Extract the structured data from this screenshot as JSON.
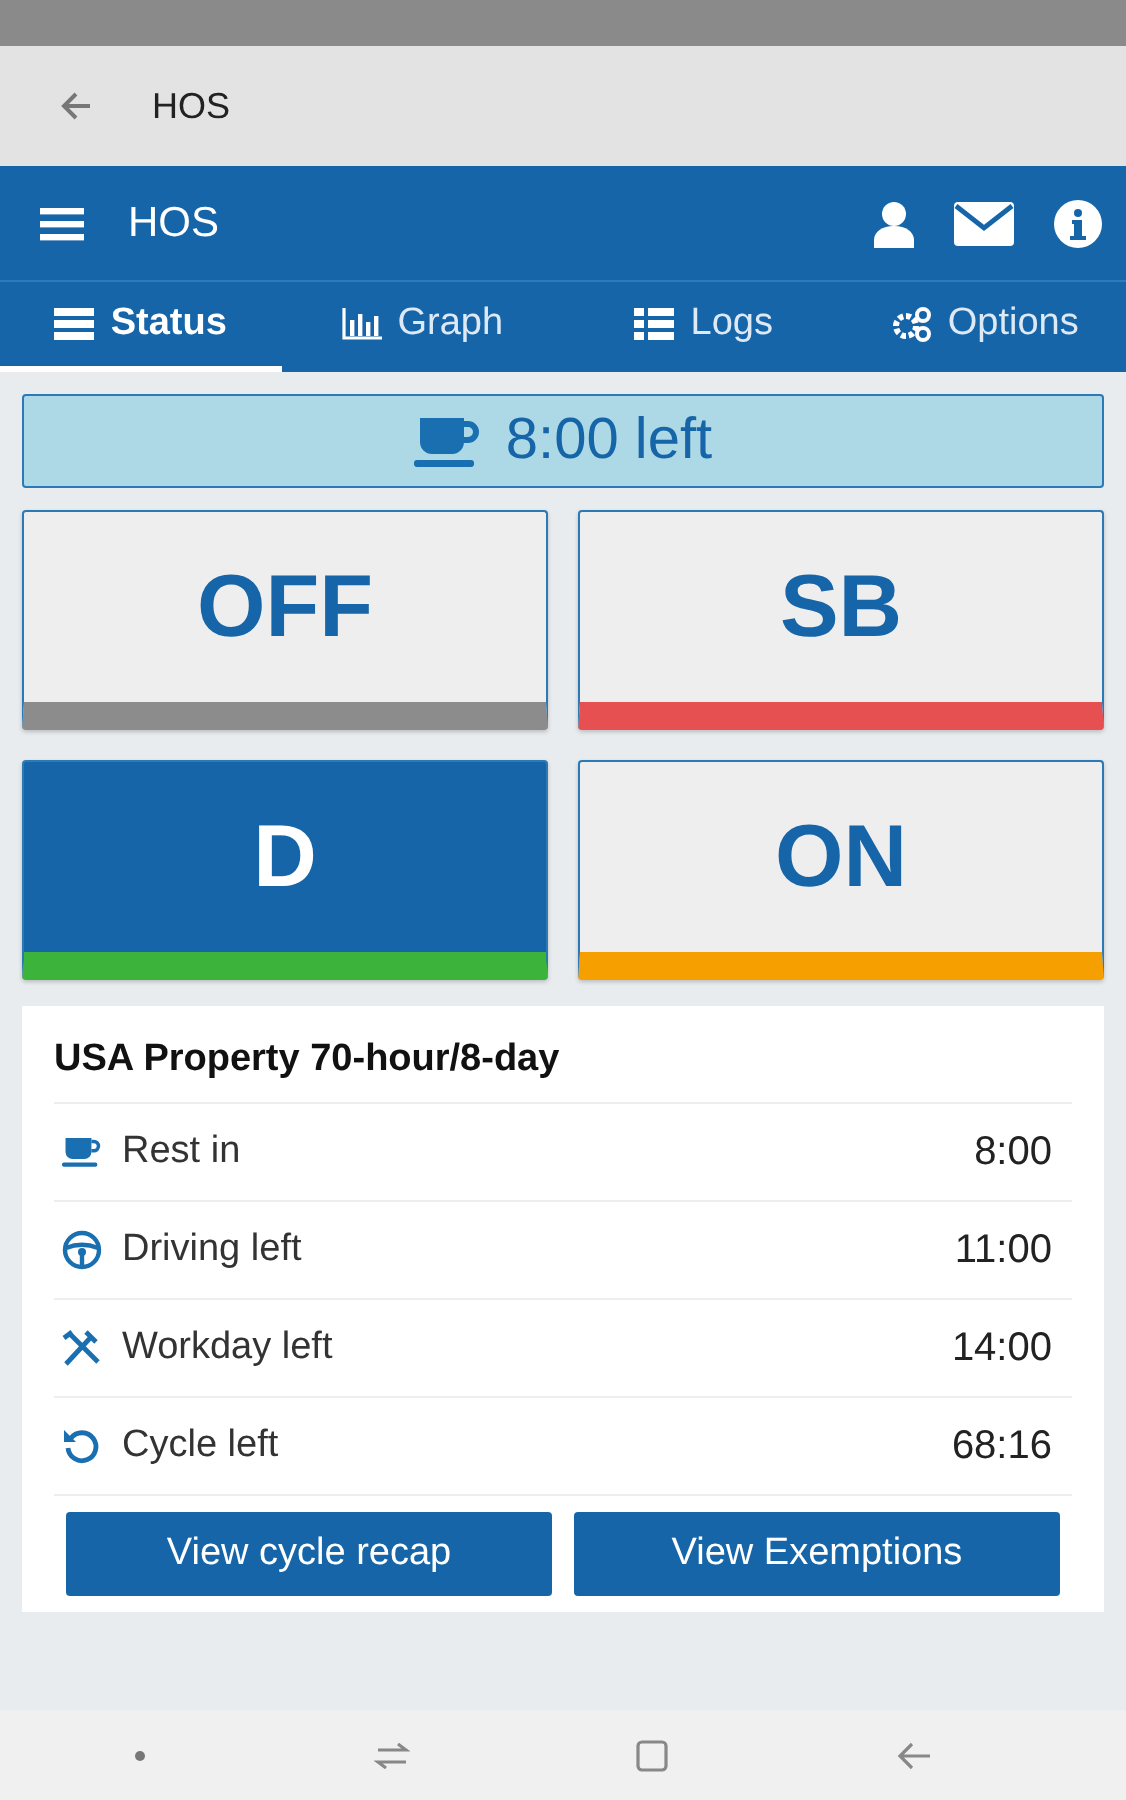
{
  "app_bar": {
    "title": "HOS"
  },
  "header": {
    "title": "HOS"
  },
  "tabs": [
    {
      "label": "Status",
      "selected": true
    },
    {
      "label": "Graph",
      "selected": false
    },
    {
      "label": "Logs",
      "selected": false
    },
    {
      "label": "Options",
      "selected": false
    }
  ],
  "banner": {
    "text": "8:00 left"
  },
  "duty_statuses": [
    {
      "label": "OFF",
      "color": "#8c8c8c",
      "selected": false
    },
    {
      "label": "SB",
      "color": "#e65050",
      "selected": false
    },
    {
      "label": "D",
      "color": "#3cb43c",
      "selected": true
    },
    {
      "label": "ON",
      "color": "#f5a000",
      "selected": false
    }
  ],
  "rule_card": {
    "title": "USA Property 70-hour/8-day",
    "rows": [
      {
        "label": "Rest in",
        "value": "8:00"
      },
      {
        "label": "Driving left",
        "value": "11:00"
      },
      {
        "label": "Workday left",
        "value": "14:00"
      },
      {
        "label": "Cycle left",
        "value": "68:16"
      }
    ],
    "buttons": [
      "View cycle recap",
      "View Exemptions"
    ]
  }
}
